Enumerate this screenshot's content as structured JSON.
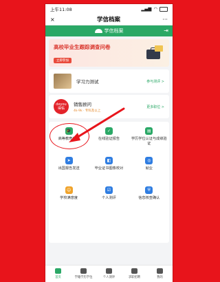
{
  "status": {
    "time": "上午11:08"
  },
  "nav": {
    "close": "×",
    "title": "学信档案",
    "more": "···"
  },
  "brand": {
    "name": "学信档案"
  },
  "banner": {
    "title": "高校毕业生跟踪调查问卷",
    "button": "立即参加"
  },
  "cards": [
    {
      "title": "学习力测试",
      "link": "参与测评 >"
    },
    {
      "title": "销售顾问",
      "sub": "4k-9k · 专科及以上",
      "link": "更多职位 >",
      "logo_top": "deyou",
      "logo_bottom": "得佑"
    }
  ],
  "grid": [
    {
      "label": "高等教育信息",
      "icon": "graduation-cap-icon",
      "color": "#2aa866"
    },
    {
      "label": "在线验证报告",
      "icon": "shield-check-icon",
      "color": "#2aa866"
    },
    {
      "label": "学历学位认证与成绩验证",
      "icon": "certificate-icon",
      "color": "#2aa866"
    },
    {
      "label": "出国报告发送",
      "icon": "send-icon",
      "color": "#2f7de1"
    },
    {
      "label": "毕业证书图像校对",
      "icon": "user-image-icon",
      "color": "#2f7de1"
    },
    {
      "label": "就业",
      "icon": "offer-icon",
      "color": "#2f7de1"
    },
    {
      "label": "学校满意度",
      "icon": "smile-icon",
      "color": "#f0a32a"
    },
    {
      "label": "个人测评",
      "icon": "checklist-icon",
      "color": "#2f7de1"
    },
    {
      "label": "信息核查确认",
      "icon": "shield-user-icon",
      "color": "#2f7de1"
    }
  ],
  "tabs": [
    {
      "label": "首页",
      "active": true
    },
    {
      "label": "学籍学历学位"
    },
    {
      "label": "个人测评"
    },
    {
      "label": "求职招聘"
    },
    {
      "label": "我的"
    }
  ]
}
